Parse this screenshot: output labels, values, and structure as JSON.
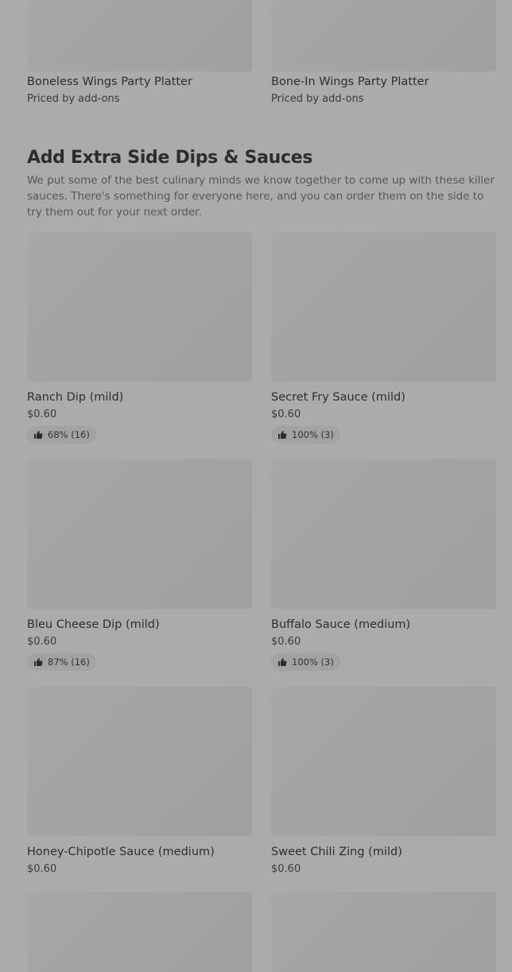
{
  "top_items": [
    {
      "name": "Boneless Wings Party Platter",
      "price": "Priced by add-ons"
    },
    {
      "name": "Bone-In Wings Party Platter",
      "price": "Priced by add-ons"
    }
  ],
  "section": {
    "title": "Add Extra Side Dips & Sauces",
    "description": "We put some of the best culinary minds we know together to come up with these killer sauces. There's something for everyone here, and you can order them on the side to try them out for your next order."
  },
  "items": [
    {
      "name": "Ranch Dip (mild)",
      "price": "$0.60",
      "rating": "68% (16)"
    },
    {
      "name": "Secret Fry Sauce (mild)",
      "price": "$0.60",
      "rating": "100% (3)"
    },
    {
      "name": "Bleu Cheese Dip (mild)",
      "price": "$0.60",
      "rating": "87% (16)"
    },
    {
      "name": "Buffalo Sauce (medium)",
      "price": "$0.60",
      "rating": "100% (3)"
    },
    {
      "name": "Honey-Chipotle Sauce (medium)",
      "price": "$0.60"
    },
    {
      "name": "Sweet Chili Zing (mild)",
      "price": "$0.60"
    }
  ],
  "icons": {
    "rating": "thumbs-up-icon"
  },
  "colors": {
    "background": "#ababab",
    "image_placeholder": "#a5a5a5",
    "rating_pill": "#a2a2a2"
  }
}
